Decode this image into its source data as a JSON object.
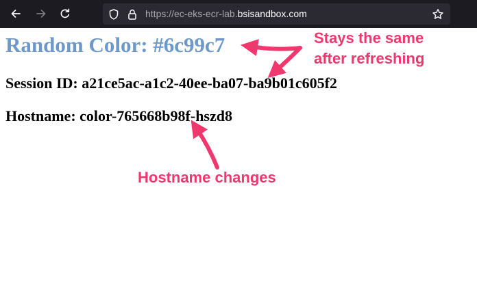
{
  "browser": {
    "url_prefix": "https://ec-eks-ecr-lab.",
    "url_domain": "bsisandbox.com"
  },
  "page": {
    "heading": "Random Color: #6c99c7",
    "heading_color": "#6c99c7",
    "session_id": "Session ID: a21ce5ac-a1c2-40ee-ba07-ba9b01c605f2",
    "hostname": "Hostname: color-765668b98f-hszd8"
  },
  "annotations": {
    "color": "#f0376e",
    "stays_same_line1": "Stays the same",
    "stays_same_line2": "after refreshing",
    "hostname_changes": "Hostname changes"
  },
  "icons": {
    "back": "arrow-left-icon",
    "forward": "arrow-right-icon",
    "reload": "reload-icon",
    "tracking": "shield-icon",
    "lock": "lock-icon",
    "bookmark": "star-icon"
  }
}
